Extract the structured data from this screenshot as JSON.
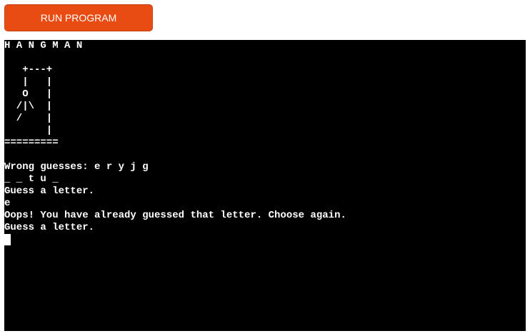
{
  "toolbar": {
    "run_label": "RUN PROGRAM",
    "accent": "#e84c12"
  },
  "terminal": {
    "background": "#000000",
    "foreground": "#ffffff",
    "lines": [
      "H A N G M A N",
      "",
      "   +---+",
      "   |   |",
      "   O   |",
      "  /|\\  |",
      "  /    |",
      "       |",
      "=========",
      "",
      "Wrong guesses: e r y j g",
      "_ _ t u _",
      "Guess a letter.",
      "e",
      "Oops! You have already guessed that letter. Choose again.",
      "Guess a letter."
    ]
  }
}
